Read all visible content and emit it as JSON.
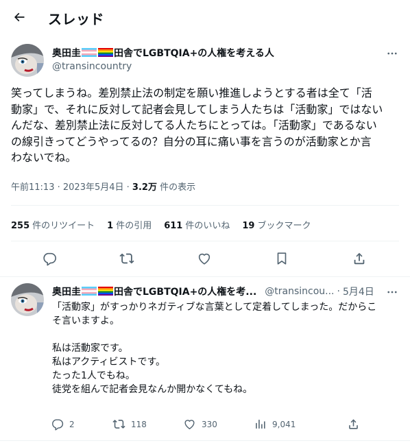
{
  "header": {
    "title": "スレッド",
    "back_icon": "arrow-left-icon"
  },
  "tweet": {
    "name_prefix": "奥田圭",
    "name_suffix": "田舎でLGBTQIA+の人権を考える人",
    "handle": "@transincountry",
    "text": "笑ってしまうね。差別禁止法の制定を願い推進しようとする者は全て「活\n動家」で、それに反対して記者会見してしまう人たちは「活動家」ではない\nんだな、差別禁止法に反対してる人たちにとっては。「活動家」であるない\nの線引きってどうやってるの？自分の耳に痛い事を言うのが活動家とか言\nわないでね。",
    "time": "午前11:13",
    "date": "2023年5月4日",
    "views_count": "3.2万",
    "views_label": "件の表示",
    "stats": [
      {
        "count": "255",
        "label": "件のリツイート"
      },
      {
        "count": "1",
        "label": "件の引用"
      },
      {
        "count": "611",
        "label": "件のいいね"
      },
      {
        "count": "19",
        "label": "ブックマーク"
      }
    ]
  },
  "reply": {
    "name_prefix": "奥田圭",
    "name_suffix": "田舎でLGBTQIA+の人権を考...",
    "handle": "@transincou...",
    "date": "5月4日",
    "text": "「活動家」がすっかりネガティブな言葉として定着してしまった。だからこ\nそ言いますよ。\n\n私は活動家です。\n私はアクティビストです。\nたった1人でもね。\n徒党を組んで記者会見なんか開かなくてもね。",
    "replies": "2",
    "retweets": "118",
    "likes": "330",
    "views": "9,041"
  },
  "colors": {
    "text": "#0f1419",
    "secondary": "#536471",
    "divider": "#eff3f4"
  }
}
